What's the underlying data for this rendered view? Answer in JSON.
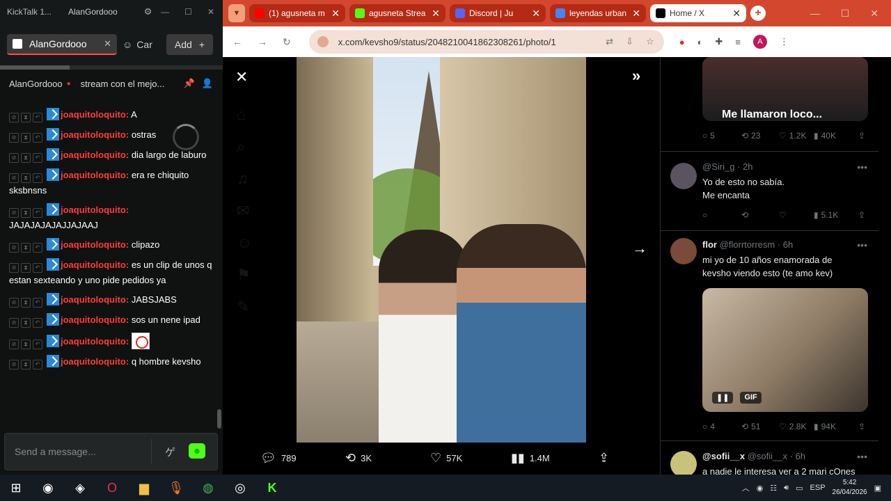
{
  "chat_app": {
    "title": "KickTalk 1...",
    "channel_name": "AlanGordooo",
    "tab_label": "AlanGordooo",
    "tab2_label": "Car",
    "add_label": "Add",
    "stream_user": "AlanGordooo",
    "stream_title": "stream con el mejo...",
    "input_placeholder": "Send a message...",
    "messages": [
      {
        "user": "joaquitoloquito:",
        "text": "A"
      },
      {
        "user": "joaquitoloquito:",
        "text": "ostras"
      },
      {
        "user": "joaquitoloquito:",
        "text": "dia largo de laburo"
      },
      {
        "user": "joaquitoloquito:",
        "text": "era re chiquito sksbnsns"
      },
      {
        "user": "joaquitoloquito:",
        "text": "JAJAJAJAJAJJAJAAJ"
      },
      {
        "user": "joaquitoloquito:",
        "text": "clipazo"
      },
      {
        "user": "joaquitoloquito:",
        "text": "es un clip de unos q estan sexteando y uno pide pedidos ya"
      },
      {
        "user": "joaquitoloquito:",
        "text": "JABSJABS"
      },
      {
        "user": "joaquitoloquito:",
        "text": "sos un nene ipad"
      },
      {
        "user": "joaquitoloquito:",
        "text": ""
      },
      {
        "user": "joaquitoloquito:",
        "text": "q hombre kevsho"
      }
    ]
  },
  "browser": {
    "tabs": [
      {
        "label": "(1) agusneta m",
        "favicon": "youtube",
        "color": "#ff0000"
      },
      {
        "label": "agusneta Strea",
        "favicon": "kick",
        "color": "#53fc18"
      },
      {
        "label": "Discord | Ju",
        "favicon": "discord",
        "color": "#5865f2"
      },
      {
        "label": "leyendas urban",
        "favicon": "google",
        "color": "#4285f4"
      },
      {
        "label": "Home / X",
        "favicon": "x",
        "color": "#000000"
      }
    ],
    "url": "x.com/kevsho9/status/2048210041862308261/photo/1",
    "profile_initial": "A"
  },
  "post": {
    "replies": "789",
    "reposts": "3K",
    "likes": "57K",
    "views": "1.4M"
  },
  "replies_panel": [
    {
      "media_caption": "Me llamaron loco...",
      "stats": [
        "5",
        "23",
        "1.2K",
        "40K"
      ]
    },
    {
      "name": "",
      "handle": "@Siri_g",
      "time": "2h",
      "text": "Yo de esto no sabía.\nMe encanta",
      "stats": [
        "",
        "",
        "",
        "5.1K"
      ]
    },
    {
      "name": "flor",
      "handle": "@florrtorresm",
      "time": "6h",
      "text": "mi yo de 10 años enamorada de kevsho viendo esto (te amo kev)",
      "media_badge": "GIF",
      "stats": [
        "4",
        "51",
        "2.8K",
        "94K"
      ]
    },
    {
      "name": "@sofii__x",
      "handle": "@sofii__x",
      "time": "6h",
      "text": "a nadie le interesa ver a 2 mari cOnes"
    }
  ],
  "taskbar": {
    "lang": "ESP",
    "time": "5:42",
    "date": "26/04/2026"
  }
}
